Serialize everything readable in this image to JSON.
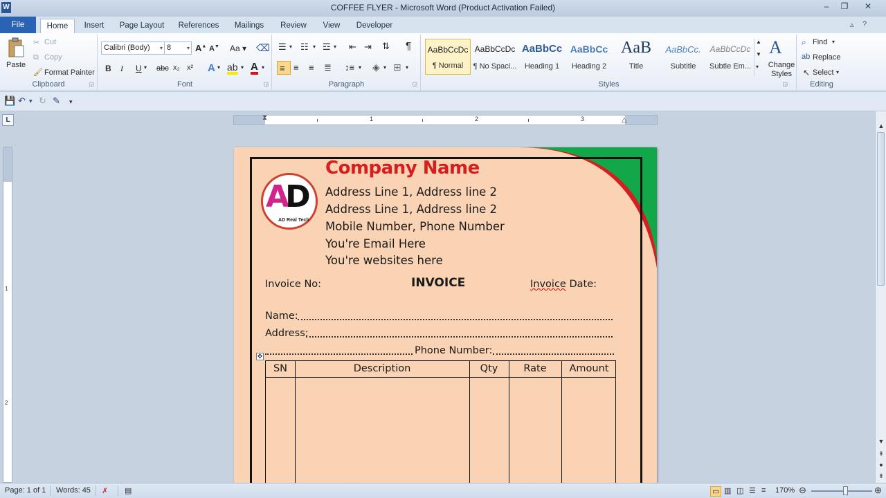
{
  "window": {
    "title": "COFFEE FLYER  -  Microsoft Word (Product Activation Failed)",
    "app_icon": "W",
    "minimize": "–",
    "maximize": "❐",
    "close": "✕"
  },
  "tabs": [
    "File",
    "Home",
    "Insert",
    "Page Layout",
    "References",
    "Mailings",
    "Review",
    "View",
    "Developer"
  ],
  "active_tab": "Home",
  "ribbon": {
    "clipboard": {
      "label": "Clipboard",
      "paste": "Paste",
      "cut": "Cut",
      "copy": "Copy",
      "format_painter": "Format Painter"
    },
    "font": {
      "label": "Font",
      "font_name": "Calibri (Body)",
      "font_size": "8",
      "grow": "A",
      "shrink": "A",
      "change_case": "Aa",
      "bold": "B",
      "italic": "I",
      "underline": "U",
      "strike": "abc",
      "subscript": "x₂",
      "superscript": "x²"
    },
    "paragraph": {
      "label": "Paragraph",
      "pilcrow": "¶"
    },
    "styles": {
      "label": "Styles",
      "items": [
        {
          "sample": "AaBbCcDc",
          "name": "¶ Normal"
        },
        {
          "sample": "AaBbCcDc",
          "name": "¶ No Spaci..."
        },
        {
          "sample": "AaBbCc",
          "name": "Heading 1"
        },
        {
          "sample": "AaBbCc",
          "name": "Heading 2"
        },
        {
          "sample": "AaB",
          "name": "Title"
        },
        {
          "sample": "AaBbCc.",
          "name": "Subtitle"
        },
        {
          "sample": "AaBbCcDc",
          "name": "Subtle Em..."
        }
      ],
      "change_styles": "Change Styles"
    },
    "editing": {
      "label": "Editing",
      "find": "Find",
      "replace": "Replace",
      "select": "Select"
    }
  },
  "ruler": {
    "numbers": [
      "1",
      "2",
      "3"
    ],
    "vnumbers": [
      "1",
      "2"
    ]
  },
  "document": {
    "company_name": "Company Name",
    "address1": "Address Line 1, Address line 2",
    "address2": "Address Line 1, Address line 2",
    "mobile": "Mobile Number, Phone Number",
    "email": "You're Email Here",
    "website": "You're websites here",
    "invoice_no": "Invoice No:",
    "invoice_title": "INVOICE",
    "invoice_date_word": "Invoice",
    "invoice_date_rest": " Date:",
    "name_label": "Name:",
    "address_label": "Address:",
    "phone_label": "Phone  Number:",
    "logo_text": "AD",
    "logo_letter1": "A",
    "logo_letter2": "D",
    "logo_tag": "AD Real Tech",
    "table_headers": [
      "SN",
      "Description",
      "Qty",
      "Rate",
      "Amount"
    ]
  },
  "status": {
    "page": "Page: 1 of 1",
    "words": "Words: 45",
    "zoom": "170%"
  },
  "colors": {
    "page_bg": "#f9d3b4",
    "company_red": "#d71d1d",
    "corner_green": "#12a84a"
  }
}
